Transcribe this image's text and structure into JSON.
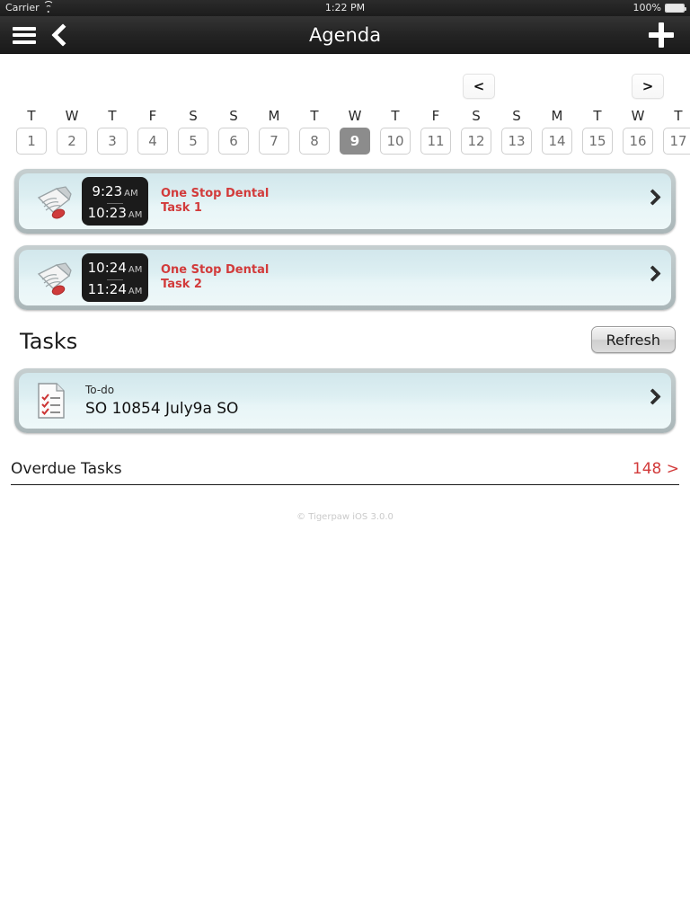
{
  "statusbar": {
    "carrier": "Carrier",
    "wifi_icon": "wifi-icon",
    "time": "1:22 PM",
    "battery_percent": "100%",
    "battery_icon": "battery-full-icon"
  },
  "navbar": {
    "menu_icon": "hamburger-menu-icon",
    "back_icon": "chevron-left-icon",
    "title": "Agenda",
    "add_icon": "plus-icon"
  },
  "pager": {
    "prev_label": "<",
    "next_label": ">"
  },
  "datestrip": {
    "days": [
      {
        "name": "T",
        "num": "1",
        "selected": false
      },
      {
        "name": "W",
        "num": "2",
        "selected": false
      },
      {
        "name": "T",
        "num": "3",
        "selected": false
      },
      {
        "name": "F",
        "num": "4",
        "selected": false
      },
      {
        "name": "S",
        "num": "5",
        "selected": false
      },
      {
        "name": "S",
        "num": "6",
        "selected": false
      },
      {
        "name": "M",
        "num": "7",
        "selected": false
      },
      {
        "name": "T",
        "num": "8",
        "selected": false
      },
      {
        "name": "W",
        "num": "9",
        "selected": true
      },
      {
        "name": "T",
        "num": "10",
        "selected": false
      },
      {
        "name": "F",
        "num": "11",
        "selected": false
      },
      {
        "name": "S",
        "num": "12",
        "selected": false
      },
      {
        "name": "S",
        "num": "13",
        "selected": false
      },
      {
        "name": "M",
        "num": "14",
        "selected": false
      },
      {
        "name": "T",
        "num": "15",
        "selected": false
      },
      {
        "name": "W",
        "num": "16",
        "selected": false
      },
      {
        "name": "T",
        "num": "17",
        "selected": false
      }
    ]
  },
  "appointments": [
    {
      "icon": "hand-holding-document-icon",
      "start_time": "9:23",
      "start_meridiem": "AM",
      "end_time": "10:23",
      "end_meridiem": "AM",
      "title": "One Stop Dental",
      "subtitle": "Task 1",
      "chevron_icon": "chevron-right-icon"
    },
    {
      "icon": "hand-holding-document-icon",
      "start_time": "10:24",
      "start_meridiem": "AM",
      "end_time": "11:24",
      "end_meridiem": "AM",
      "title": "One Stop Dental",
      "subtitle": "Task 2",
      "chevron_icon": "chevron-right-icon"
    }
  ],
  "tasks_section": {
    "heading": "Tasks",
    "refresh_label": "Refresh",
    "items": [
      {
        "icon": "checklist-document-icon",
        "kind": "To-do",
        "name": "SO 10854 July9a SO",
        "chevron_icon": "chevron-right-icon"
      }
    ]
  },
  "overdue": {
    "label": "Overdue Tasks",
    "count": "148 >"
  },
  "footer": {
    "text": "© Tigerpaw iOS 3.0.0"
  },
  "colors": {
    "accent_red": "#d23b3b",
    "card_blue": "#ddeff2",
    "selected_day": "#8c8c8c",
    "navbar_dark": "#242424"
  }
}
